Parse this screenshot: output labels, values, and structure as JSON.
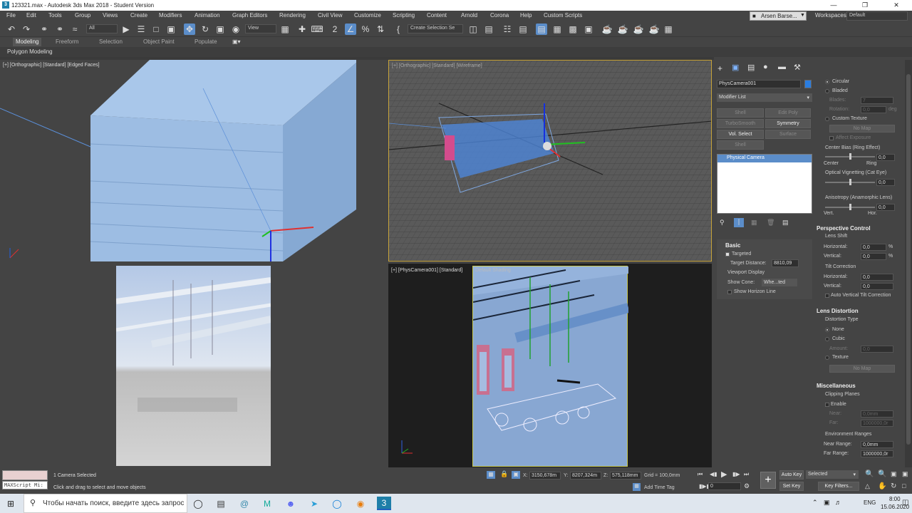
{
  "window": {
    "title": "123321.max - Autodesk 3ds Max 2018 - Student Version",
    "app_icon_text": "3"
  },
  "menu": [
    "File",
    "Edit",
    "Tools",
    "Group",
    "Views",
    "Create",
    "Modifiers",
    "Animation",
    "Graph Editors",
    "Rendering",
    "Civil View",
    "Customize",
    "Scripting",
    "Content",
    "Arnold",
    "Corona",
    "Help",
    "Custom Scripts"
  ],
  "user": {
    "name": "Arsen Barse...",
    "workspaces_label": "Workspaces:",
    "workspace_value": "Default"
  },
  "toolbar": {
    "filter_value": "All",
    "view_value": "View",
    "selection_set_placeholder": "Create Selection Se"
  },
  "ribbon": {
    "tabs": [
      "Modeling",
      "Freeform",
      "Selection",
      "Object Paint",
      "Populate"
    ],
    "active_tab": "Modeling",
    "sub_label": "Polygon Modeling"
  },
  "viewports": {
    "top_left": "[+] [Orthographic] [Standard] [Edged Faces]",
    "top_right": "[+] [Orthographic] [Standard] [Wireframe]",
    "bottom_right_prefix": "[+] [PhysCamera001] [Standard]",
    "bottom_right_shading": "Default Shading"
  },
  "command_panel": {
    "object_name": "PhysCamera001",
    "object_color": "#2a7de0",
    "modifier_list": "Modifier List",
    "buttons": [
      {
        "label": "Shell",
        "enabled": false
      },
      {
        "label": "Edit Poly",
        "enabled": false
      },
      {
        "label": "TurboSmooth",
        "enabled": false
      },
      {
        "label": "Symmetry",
        "enabled": true
      },
      {
        "label": "Vol. Select",
        "enabled": true
      },
      {
        "label": "Surface",
        "enabled": false
      },
      {
        "label": "Shell",
        "enabled": false
      }
    ],
    "stack_item": "Physical Camera",
    "basic": {
      "header": "Basic",
      "targeted": "Targeted",
      "target_distance_label": "Target Distance:",
      "target_distance_value": "8810,09",
      "viewport_display": "Viewport Display",
      "show_cone_label": "Show Cone:",
      "show_cone_value": "Whe...ted",
      "show_horizon": "Show Horizon Line"
    }
  },
  "rollout": {
    "aperture": {
      "circular": "Circular",
      "bladed": "Bladed",
      "blades_label": "Blades:",
      "blades_value": "7",
      "rotation_label": "Rotation:",
      "rotation_value": "0,0",
      "rotation_unit": "deg",
      "custom_texture": "Custom Texture",
      "no_map": "No Map",
      "affect_exposure": "Affect Exposure",
      "center_bias": "Center Bias (Ring Effect)",
      "center_bias_value": "0,0",
      "center": "Center",
      "ring": "Ring",
      "optical_vignetting": "Optical Vignetting (Cat Eye)",
      "vignetting_value": "0,0",
      "anisotropy": "Anisotropy (Anamorphic Lens)",
      "anisotropy_value": "0,0",
      "vert": "Vert.",
      "hor": "Hor."
    },
    "perspective": {
      "header": "Perspective Control",
      "lens_shift": "Lens Shift",
      "horizontal_label": "Horizontal:",
      "horizontal_value": "0,0",
      "vertical_label": "Vertical:",
      "vertical_value": "0,0",
      "percent": "%",
      "tilt_correction": "Tilt Correction",
      "tilt_h_value": "0,0",
      "tilt_v_value": "0,0",
      "auto_tilt": "Auto Vertical Tilt Correction"
    },
    "distortion": {
      "header": "Lens Distortion",
      "type_label": "Distortion Type",
      "none": "None",
      "cubic": "Cubic",
      "amount_label": "Amount:",
      "amount_value": "0,0",
      "texture": "Texture",
      "no_map": "No Map"
    },
    "misc": {
      "header": "Miscellaneous",
      "clipping_planes": "Clipping Planes",
      "enable": "Enable",
      "near_label": "Near:",
      "near_value": "0,0mm",
      "far_label": "Far:",
      "far_value": "1000000,0r",
      "env_ranges": "Environment Ranges",
      "near_range_label": "Near Range:",
      "near_range_value": "0,0mm",
      "far_range_label": "Far Range:",
      "far_range_value": "1000000,0r"
    }
  },
  "status": {
    "maxscript": "MAXScript Mi:",
    "selected_text": "1 Camera Selected",
    "prompt_text": "Click and drag to select and move objects",
    "x_label": "X:",
    "x_value": "3150,678m",
    "y_label": "Y:",
    "y_value": "8207,324m",
    "z_label": "Z:",
    "z_value": "575,118mm",
    "grid_text": "Grid = 100,0mm",
    "add_time_tag": "Add Time Tag",
    "frame_value": "0",
    "auto_key": "Auto Key",
    "selected_dropdown": "Selected",
    "set_key": "Set Key",
    "key_filters": "Key Filters..."
  },
  "taskbar": {
    "search_placeholder": "Чтобы начать поиск, введите здесь запрос",
    "language": "ENG",
    "time": "8:00",
    "date": "15.06.2020"
  }
}
